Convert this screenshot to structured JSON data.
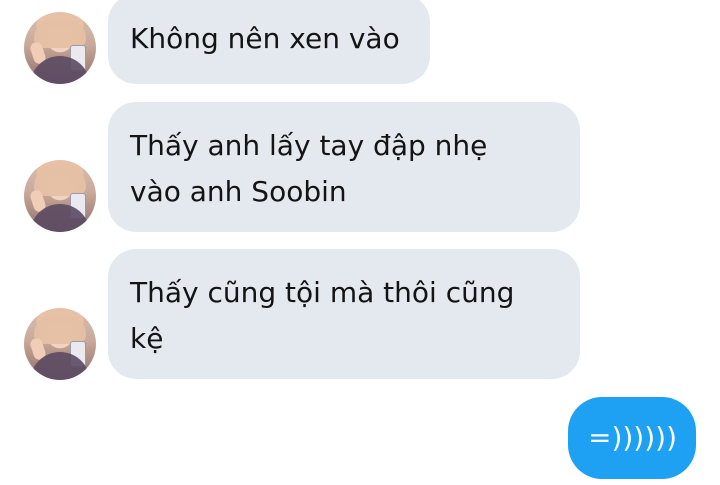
{
  "messages": [
    {
      "id": "m1",
      "direction": "incoming",
      "text": "Không nên xen vào"
    },
    {
      "id": "m2",
      "direction": "incoming",
      "text": "Thấy anh lấy tay đập nhẹ vào anh Soobin"
    },
    {
      "id": "m3",
      "direction": "incoming",
      "text": "Thấy cũng tội mà thôi cũng kệ"
    },
    {
      "id": "m4",
      "direction": "outgoing",
      "text": "=))))))"
    }
  ],
  "colors": {
    "incoming_bubble": "#e4e9ef",
    "outgoing_bubble": "#1ea1f2",
    "incoming_text": "#141414",
    "outgoing_text": "#ffffff"
  },
  "icons": {
    "avatar": "profile-photo-avatar"
  }
}
